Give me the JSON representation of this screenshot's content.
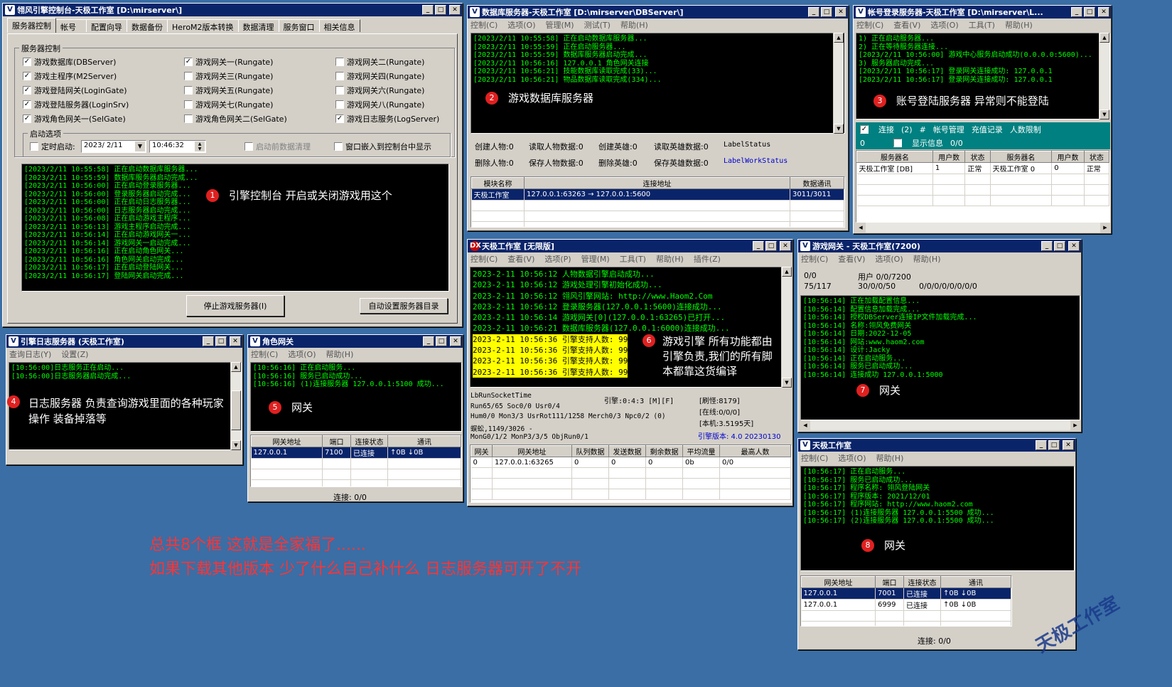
{
  "colors": {
    "desktop": "#3a6ea5",
    "titlebar": "#0a246a",
    "log_text": "#00ff00",
    "badge": "#e02020",
    "summary_text": "#ff3333"
  },
  "w1": {
    "title": "翎风引擎控制台-天极工作室 [D:\\mirserver\\]",
    "icon": "v-icon",
    "tabs": [
      "服务器控制",
      "帐号",
      "配置向导",
      "数据备份",
      "HeroM2版本转换",
      "数据清理",
      "服务窗口",
      "相关信息"
    ],
    "group_label": "服务器控制",
    "checks": [
      {
        "label": "游戏数据库(DBServer)",
        "checked": true
      },
      {
        "label": "游戏主程序(M2Server)",
        "checked": true
      },
      {
        "label": "游戏登陆网关(LoginGate)",
        "checked": true
      },
      {
        "label": "游戏登陆服务器(LoginSrv)",
        "checked": true
      },
      {
        "label": "游戏角色网关一(SelGate)",
        "checked": true
      },
      {
        "label": "游戏网关一(Rungate)",
        "checked": true
      },
      {
        "label": "游戏网关三(Rungate)",
        "checked": false
      },
      {
        "label": "游戏网关五(Rungate)",
        "checked": false
      },
      {
        "label": "游戏网关七(Rungate)",
        "checked": false
      },
      {
        "label": "游戏角色网关二(SelGate)",
        "checked": false
      },
      {
        "label": "游戏网关二(Rungate)",
        "checked": false
      },
      {
        "label": "游戏网关四(Rungate)",
        "checked": false
      },
      {
        "label": "游戏网关六(Rungate)",
        "checked": false
      },
      {
        "label": "游戏网关八(Rungate)",
        "checked": false
      },
      {
        "label": "游戏日志服务(LogServer)",
        "checked": true
      }
    ],
    "startup_label": "启动选项",
    "timed_start_label": "定时启动:",
    "date_value": "2023/ 2/11",
    "time_value": "10:46:32",
    "pre_clean_label": "启动前数据清理",
    "embed_label": "窗口嵌入到控制台中显示",
    "log": [
      "[2023/2/11 10:55:58] 正在启动数据库服务器...",
      "[2023/2/11 10:55:59] 数据库服务器启动完成...",
      "[2023/2/11 10:56:00] 正在启动登录服务器...",
      "[2023/2/11 10:56:00] 登录服务器启动完成...",
      "[2023/2/11 10:56:00] 正在启动日志服务器...",
      "[2023/2/11 10:56:00] 日志服务器启动完成...",
      "[2023/2/11 10:56:08] 正在启动游戏主程序...",
      "[2023/2/11 10:56:13] 游戏主程序启动完成...",
      "[2023/2/11 10:56:14] 正在启动游戏网关一...",
      "[2023/2/11 10:56:14] 游戏网关一启动完成...",
      "[2023/2/11 10:56:16] 正在启动角色网关...",
      "[2023/2/11 10:56:16] 角色网关启动完成...",
      "[2023/2/11 10:56:17] 正在启动登陆网关...",
      "[2023/2/11 10:56:17] 登陆网关启动完成..."
    ],
    "stop_button": "停止游戏服务器(I)",
    "auto_dir_button": "自动设置服务器目录"
  },
  "w2": {
    "title": "数据库服务器-天极工作室 [D:\\mirserver\\DBServer\\]",
    "icon": "v-icon",
    "menu": [
      "控制(C)",
      "选项(O)",
      "管理(M)",
      "测试(T)",
      "帮助(H)"
    ],
    "log": [
      "[2023/2/11 10:55:58] 正在启动数据库服务器...",
      "[2023/2/11 10:55:59] 正在启动服务器...",
      "[2023/2/11 10:55:59] 数据库服务器启动完成...",
      "[2023/2/11 10:56:16] 127.0.0.1 角色网关连接",
      "[2023/2/11 10:56:21] 技能数据库读取完成(33)...",
      "[2023/2/11 10:56:21] 物品数据库读取完成(334)..."
    ],
    "stats_row1": [
      "创建人物:0",
      "读取人物数据:0",
      "创建英雄:0",
      "读取英雄数据:0",
      "LabelStatus"
    ],
    "stats_row2": [
      "删除人物:0",
      "保存人物数据:0",
      "删除英雄:0",
      "保存英雄数据:0",
      "LabelWorkStatus"
    ],
    "grid_headers": [
      "模块名称",
      "连接地址",
      "数据通讯"
    ],
    "grid_rows": [
      [
        "天极工作室",
        "127.0.0.1:63263 → 127.0.0.1:5600",
        "3011/3011"
      ]
    ]
  },
  "w3": {
    "title": "帐号登录服务器-天极工作室 [D:\\mirserver\\L...",
    "icon": "v-icon",
    "menu": [
      "控制(C)",
      "查看(V)",
      "选项(O)",
      "工具(T)",
      "帮助(H)"
    ],
    "log": [
      "1) 正在启动服务器...",
      "2) 正在等待服务器连接...",
      "[2023/2/11 10:56:00] 游戏中心服务启动成功(0.0.0.0:5600)...",
      "3) 服务器启动完成...",
      "[2023/2/11 10:56:17] 登录网关连接成功: 127.0.0.1",
      "[2023/2/11 10:56:17] 登录网关连接成功: 127.0.0.1"
    ],
    "bar_connect": "连接",
    "bar_count": "(2)",
    "bar_hash": "#",
    "bar_items": [
      "帐号管理",
      "充值记录",
      "人数限制"
    ],
    "row2_value": "0",
    "show_info": "显示信息",
    "row2_ratio": "0/0",
    "grid_headers": [
      "服务器名",
      "用户数",
      "状态",
      "服务器名",
      "用户数",
      "状态"
    ],
    "grid_rows": [
      [
        "天极工作室 [DB]",
        "1",
        "正常",
        "天极工作室 0",
        "0",
        "正常"
      ]
    ]
  },
  "w4": {
    "title": "引擎日志服务器 (天极工作室)",
    "icon": "v-icon",
    "menu": [
      "查询日志(Y)",
      "设置(Z)"
    ],
    "log": [
      "[10:56:00]日志服务正在启动...",
      "[10:56:00]日志服务器启动完成..."
    ]
  },
  "w5": {
    "title": "角色网关",
    "icon": "v-icon",
    "menu": [
      "控制(C)",
      "选项(O)",
      "帮助(H)"
    ],
    "log": [
      "[10:56:16] 正在启动服务...",
      "[10:56:16] 服务已启动成功...",
      "[10:56:16] (1)连接服务器 127.0.0.1:5100 成功..."
    ],
    "grid_headers": [
      "网关地址",
      "端口",
      "连接状态",
      "通讯"
    ],
    "grid_rows": [
      [
        "127.0.0.1",
        "7100",
        "已连接",
        "↑0B   ↓0B"
      ]
    ],
    "status": "连接: 0/0"
  },
  "w6": {
    "title": "天极工作室 [无限版]",
    "icon": "dx-icon",
    "menu": [
      "控制(C)",
      "查看(V)",
      "选项(P)",
      "管理(M)",
      "工具(T)",
      "帮助(H)",
      "插件(Z)"
    ],
    "log": [
      "2023-2-11  10:56:12 人物数据引擎启动成功...",
      "2023-2-11  10:56:12 游戏处理引擎初始化成功...",
      "2023-2-11  10:56:12 翎风引擎网站: http://www.Haom2.Com",
      "2023-2-11  10:56:12 登录服务器(127.0.0.1:5600)连接成功...",
      "2023-2-11  10:56:14 游戏网关[0](127.0.0.1:63265)已打开...",
      "2023-2-11  10:56:21 数据库服务器(127.0.0.1:6000)连接成功..."
    ],
    "log_hl": [
      "2023-2-11  10:56:36 引擎支持人数: 99",
      "2023-2-11  10:56:36 引擎支持人数: 99",
      "2023-2-11  10:56:36 引擎支持人数: 99",
      "2023-2-11  10:56:36 引擎支持人数: 99"
    ],
    "info_left": [
      "LbRunSocketTime",
      "Run65/65 Soc0/0 Usr0/4",
      "Hum0/0 Mon3/3 UsrRot111/1258 Merch0/3 Npc0/2 (0)",
      "蜈蚣,1149/3026 -",
      "MonG0/1/2 MonP3/3/5 ObjRun0/1"
    ],
    "engine_line": "引擎:0:4:3 [M][F]",
    "info_right": [
      "[刷怪:8179]",
      "[在线:0/0/0]",
      "[本机:3.5195天]"
    ],
    "version": "引擎版本: 4.0 20230130",
    "grid_headers": [
      "网关",
      "网关地址",
      "队列数据",
      "发送数据",
      "剩余数据",
      "平均流量",
      "最高人数"
    ],
    "grid_rows": [
      [
        "0",
        "127.0.0.1:63265",
        "0",
        "0",
        "0",
        "0b",
        "0/0"
      ]
    ]
  },
  "w7": {
    "title": "游戏网关 - 天极工作室(7200)",
    "icon": "v-icon",
    "menu": [
      "控制(C)",
      "查看(V)",
      "选项(O)",
      "帮助(H)"
    ],
    "stats_left": [
      "0/0",
      "75/117"
    ],
    "stats_mid": [
      "用户 0/0/7200",
      "30/0/0/50"
    ],
    "stats_right": "0/0/0/0/0/0/0/0",
    "log": [
      "[10:56:14] 正在加载配置信息...",
      "[10:56:14] 配置信息加载完成...",
      "[10:56:14] 授权DBServer连接IP文件加载完成...",
      "[10:56:14] 名称:翎风免费网关",
      "[10:56:14] 日期:2022-12-05",
      "[10:56:14] 网站:www.haom2.com",
      "[10:56:14] 设计:Jacky",
      "[10:56:14] 正在启动服务...",
      "[10:56:14] 服务已启动成功...",
      "[10:56:14] 连接成功 127.0.0.1:5000"
    ]
  },
  "w8": {
    "title": "天极工作室",
    "icon": "v-icon",
    "menu": [
      "控制(C)",
      "选项(O)",
      "帮助(H)"
    ],
    "log": [
      "[10:56:17] 正在启动服务...",
      "[10:56:17] 服务已启动成功...",
      "[10:56:17] 程序名称: 翎风登陆网关",
      "[10:56:17] 程序版本: 2021/12/01",
      "[10:56:17] 程序网站: http://www.haom2.com",
      "[10:56:17] (1)连接服务器 127.0.0.1:5500 成功...",
      "[10:56:17] (2)连接服务器 127.0.0.1:5500 成功..."
    ],
    "grid_headers": [
      "网关地址",
      "端口",
      "连接状态",
      "通讯"
    ],
    "grid_rows": [
      [
        "127.0.0.1",
        "7001",
        "已连接",
        "↑0B   ↓0B"
      ],
      [
        "127.0.0.1",
        "6999",
        "已连接",
        "↑0B   ↓0B"
      ]
    ],
    "status": "连接: 0/0"
  },
  "annotations": [
    {
      "n": "1",
      "text": "引擎控制台 开启或关闭游戏用这个"
    },
    {
      "n": "2",
      "text": "游戏数据库服务器"
    },
    {
      "n": "3",
      "text": "账号登陆服务器 异常则不能登陆"
    },
    {
      "n": "4",
      "text": "日志服务器 负责查询游戏里面的各种玩家",
      "text2": "操作 装备掉落等"
    },
    {
      "n": "5",
      "text": "网关"
    },
    {
      "n": "6",
      "text": "游戏引擎 所有功能都由",
      "text2": "引擎负责,我们的所有脚",
      "text3": "本都靠这货编译"
    },
    {
      "n": "7",
      "text": "网关"
    },
    {
      "n": "8",
      "text": "网关"
    }
  ],
  "summary": [
    "总共8个框 这就是全家福了......",
    "如果下载其他版本 少了什么自己补什么 日志服务器可开了不开"
  ],
  "watermark": "天极工作室"
}
